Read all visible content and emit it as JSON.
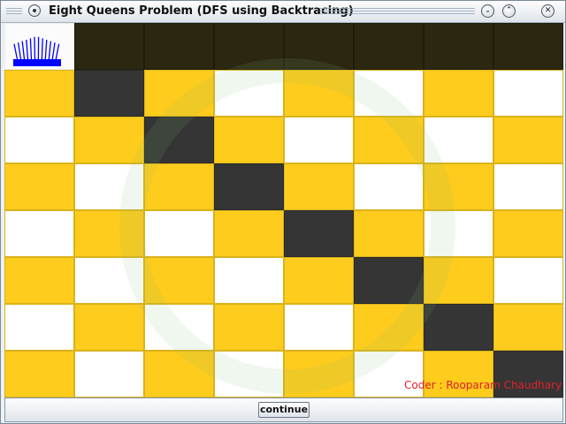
{
  "window": {
    "title": "Eight Queens Problem (DFS using Backtracing)"
  },
  "board": {
    "size": 8,
    "colors": {
      "light": "#ffffff",
      "gold": "#fecc1c",
      "dark": "#353535",
      "queen_row": "#2c2710",
      "queen_icon": "#0000ff"
    },
    "queen_columns": [
      0,
      1,
      2,
      3,
      4,
      5,
      6,
      7
    ]
  },
  "credit": "Coder : Rooparam Chaudhary",
  "buttons": {
    "continue": "continue"
  }
}
